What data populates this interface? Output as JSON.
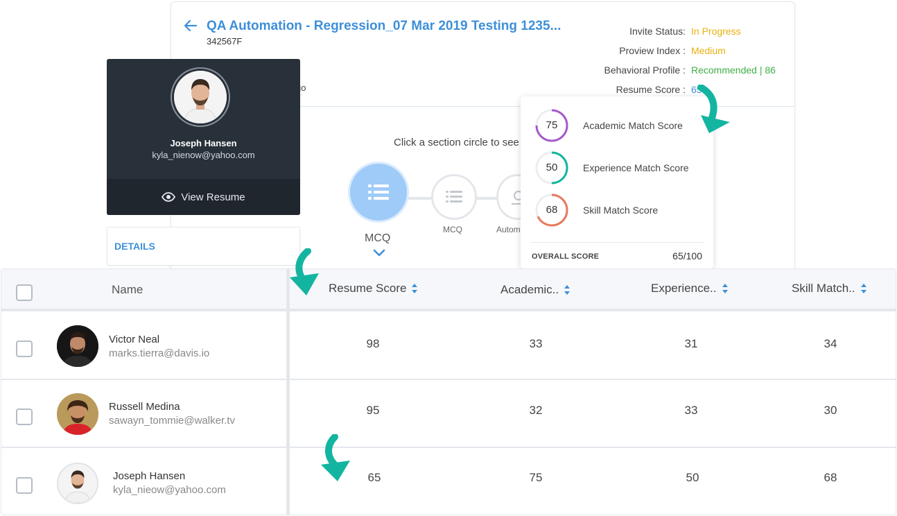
{
  "assessment": {
    "title": "QA Automation - Regression_07 Mar 2019 Testing 1235...",
    "code": "342567F",
    "location_fragment": "go",
    "hint": "Click a section circle to see"
  },
  "status": [
    {
      "label": "Invite Status:",
      "value": "In Progress",
      "color": "#e8b10e"
    },
    {
      "label": "Proview Index :",
      "value": "Medium",
      "color": "#e8b10e"
    },
    {
      "label": "Behavioral Profile :",
      "value": "Recommended | 86",
      "color": "#3fae49"
    },
    {
      "label": "Resume Score :",
      "value": "65",
      "color": "#3d8fd9"
    }
  ],
  "sections": [
    {
      "label": "MCQ",
      "active": true
    },
    {
      "label": "MCQ",
      "active": false
    },
    {
      "label": "Autom",
      "active": false
    }
  ],
  "profile": {
    "name": "Joseph Hansen",
    "email": "kyla_nienow@yahoo.com",
    "view_resume": "View Resume",
    "details": "DETAILS"
  },
  "resume_breakdown": {
    "items": [
      {
        "value": "75",
        "label": "Academic Match Score",
        "fraction": 0.75,
        "color": "#a65bc9"
      },
      {
        "value": "50",
        "label": "Experience Match Score",
        "fraction": 0.5,
        "color": "#13b5a0"
      },
      {
        "value": "68",
        "label": "Skill Match Score",
        "fraction": 0.68,
        "color": "#e67a5e"
      }
    ],
    "overall_label": "OVERALL SCORE",
    "overall_value": "65/100"
  },
  "table": {
    "headers": {
      "name": "Name",
      "resume": "Resume Score",
      "academic": "Academic..",
      "experience": "Experience..",
      "skill": "Skill Match.."
    },
    "rows": [
      {
        "name": "Victor Neal",
        "email": "marks.tierra@davis.io",
        "resume": "98",
        "academic": "33",
        "experience": "31",
        "skill": "34"
      },
      {
        "name": "Russell Medina",
        "email": "sawayn_tommie@walker.tv",
        "resume": "95",
        "academic": "32",
        "experience": "33",
        "skill": "30"
      },
      {
        "name": "Joseph Hansen",
        "email": "kyla_nieow@yahoo.com",
        "resume": "65",
        "academic": "75",
        "experience": "50",
        "skill": "68"
      }
    ]
  },
  "colors": {
    "accent": "#3d8fd9",
    "annotation_arrow": "#13b5a0",
    "profile_bg": "#283039"
  },
  "icons": [
    "back-arrow-icon",
    "list-icon",
    "chevron-down-icon",
    "eye-icon",
    "sort-icon",
    "checkbox-icon",
    "curved-arrow-icon"
  ]
}
